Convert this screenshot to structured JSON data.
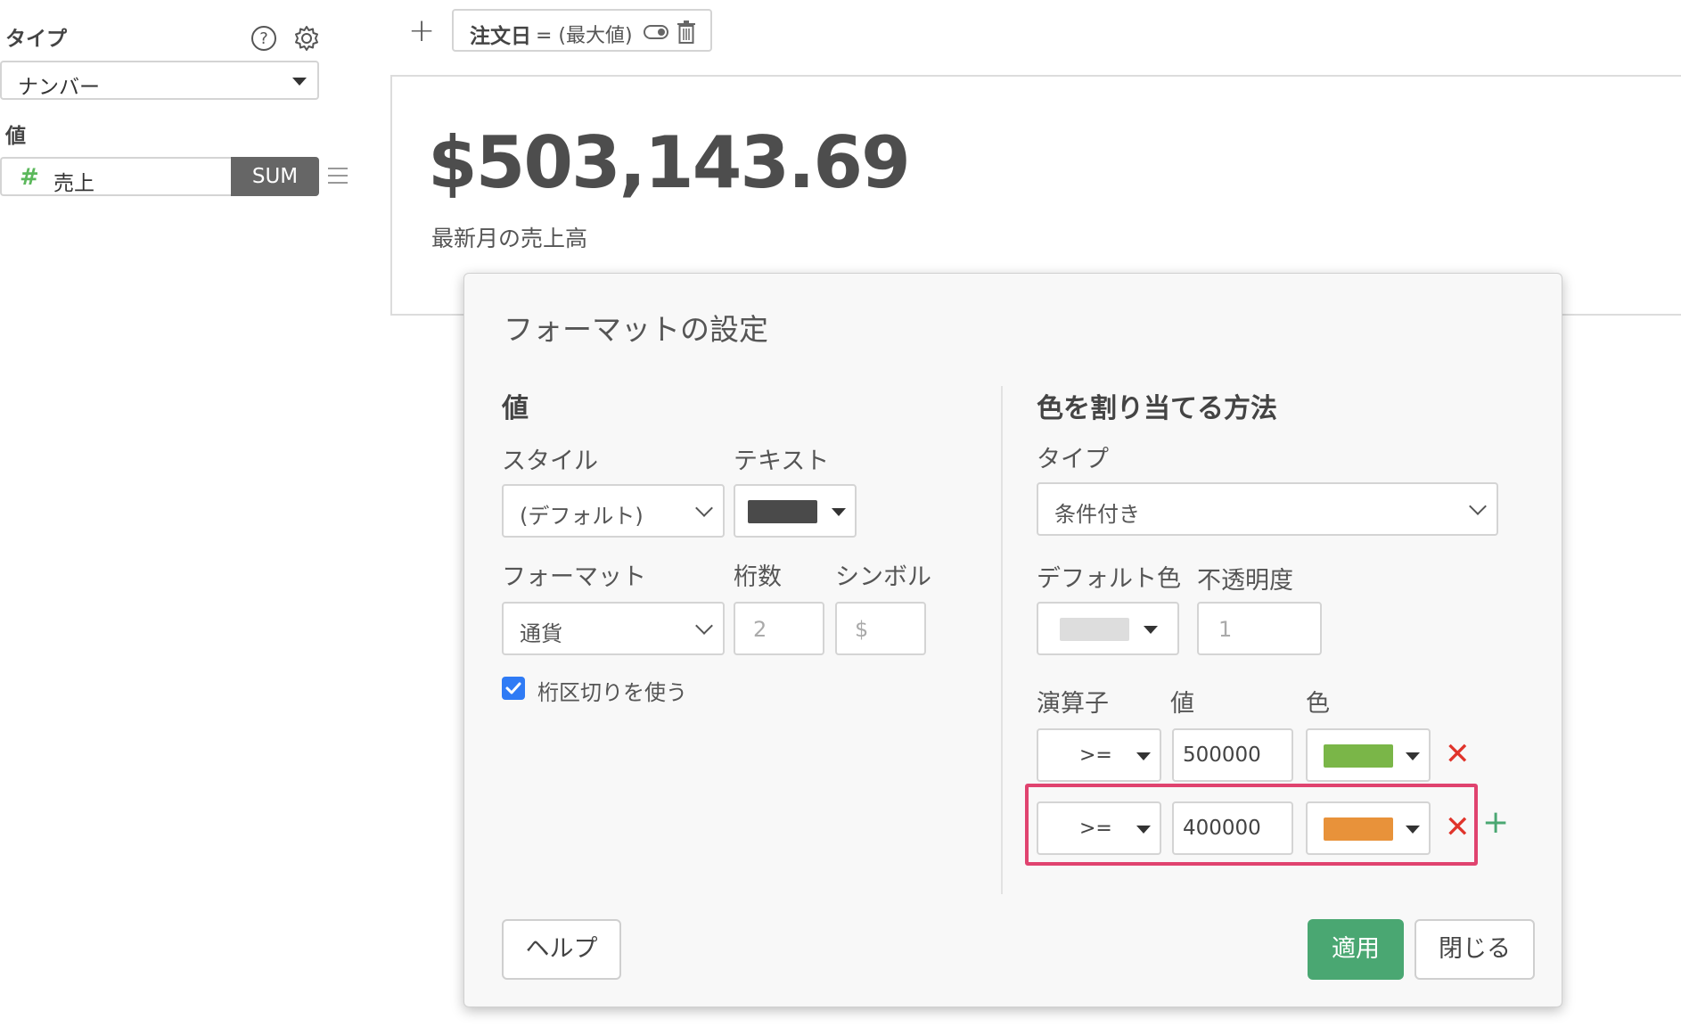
{
  "sidebar": {
    "type_label": "タイプ",
    "type_value": "ナンバー",
    "value_label": "値",
    "value_field": "売上",
    "value_agg": "SUM"
  },
  "topbar": {
    "add": "+",
    "filter_name": "注文日",
    "filter_rest": " = (最大値)"
  },
  "metric": {
    "value": "$503,143.69",
    "caption": "最新月の売上高"
  },
  "dialog": {
    "title": "フォーマットの設定",
    "left": {
      "section": "値",
      "style_label": "スタイル",
      "style_value": "(デフォルト)",
      "text_label": "テキスト",
      "text_color": "#4a4a4a",
      "format_label": "フォーマット",
      "format_value": "通貨",
      "digits_label": "桁数",
      "digits_placeholder": "2",
      "symbol_label": "シンボル",
      "symbol_placeholder": "$",
      "separator_label": "桁区切りを使う",
      "separator_checked": true
    },
    "right": {
      "section": "色を割り当てる方法",
      "type_label": "タイプ",
      "type_value": "条件付き",
      "default_color_label": "デフォルト色",
      "default_color": "#dddddd",
      "opacity_label": "不透明度",
      "opacity_placeholder": "1",
      "operator_label": "演算子",
      "value_label": "値",
      "color_label": "色",
      "rules": [
        {
          "operator": ">=",
          "value": "500000",
          "color": "#7ab648"
        },
        {
          "operator": ">=",
          "value": "400000",
          "color": "#e8923a"
        }
      ]
    },
    "help_button": "ヘルプ",
    "apply_button": "適用",
    "close_button": "閉じる"
  },
  "colors": {
    "accent_green": "#4aa772",
    "highlight": "#e0436f",
    "hash_green": "#5cb85c"
  }
}
